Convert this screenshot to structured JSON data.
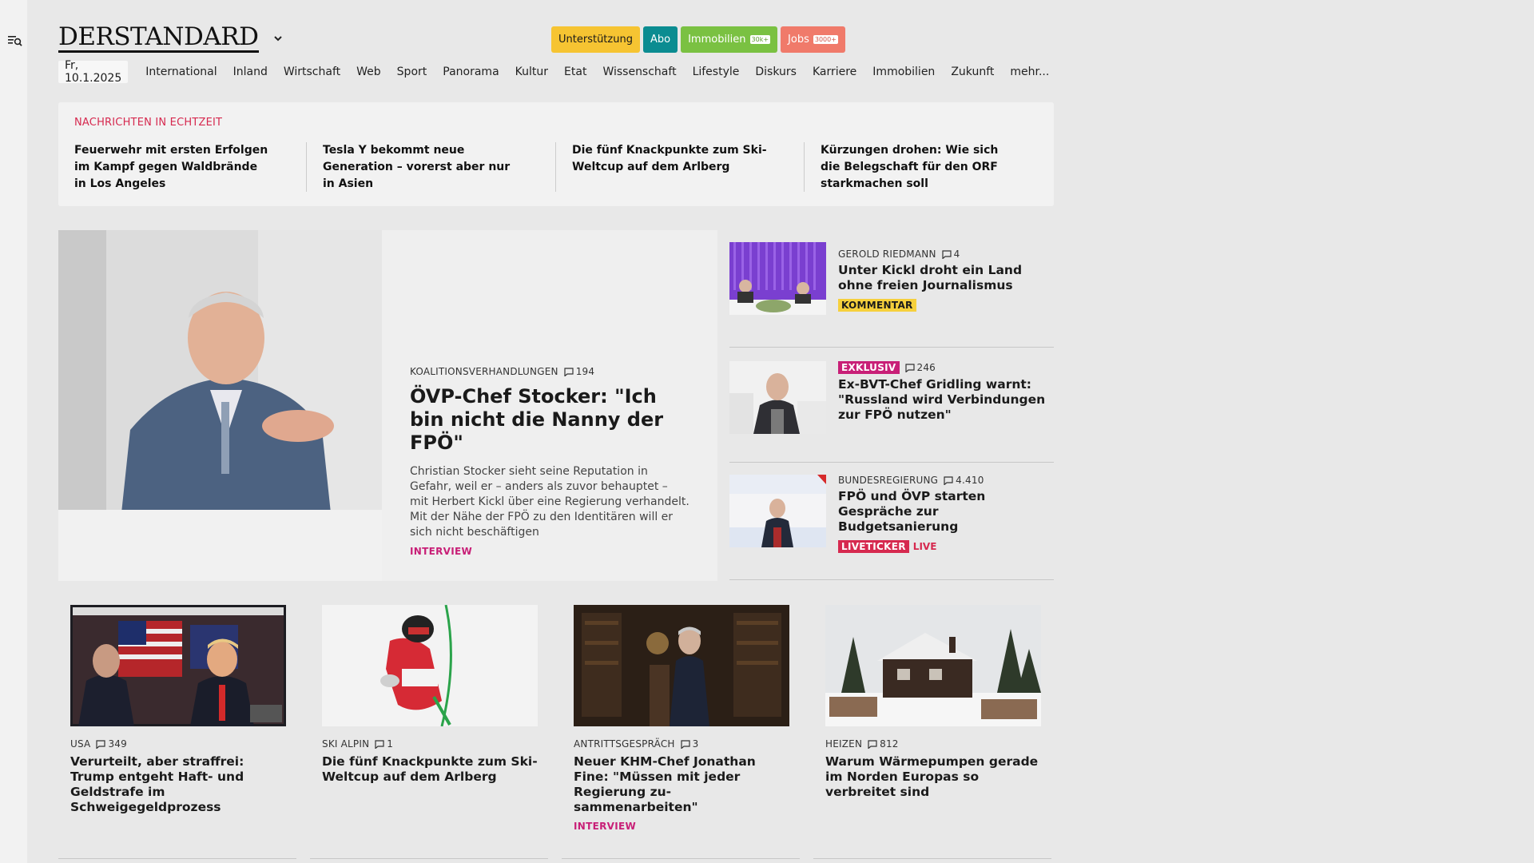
{
  "header": {
    "logo": "DERSTANDARD",
    "buttons": {
      "support": "Unterstützung",
      "abo": "Abo",
      "immobilien": "Immobilien",
      "immobilien_badge": "30k+",
      "jobs": "Jobs",
      "jobs_badge": "3000+"
    }
  },
  "nav": {
    "date": "Fr, 10.1.2025",
    "items": [
      "International",
      "Inland",
      "Wirtschaft",
      "Web",
      "Sport",
      "Panorama",
      "Kultur",
      "Etat",
      "Wissenschaft",
      "Lifestyle",
      "Diskurs",
      "Karriere",
      "Immobilien",
      "Zukunft",
      "mehr..."
    ]
  },
  "realtime": {
    "label": "NACHRICHTEN IN ECHTZEIT",
    "items": [
      "Feuerwehr mit ersten Erfolgen im Kampf gegen Waldbrände in Los Angeles",
      "Tesla Y bekommt neue Generation – vorerst aber nur in Asien",
      "Die fünf Knackpunkte zum Ski-Welt­cup auf dem Arlberg",
      "Kürzungen drohen: Wie sich die Be­legschaft für den ORF starkmachen soll"
    ]
  },
  "hero": {
    "kicker": "KOALITIONSVERHANDLUNGEN",
    "comments": "194",
    "title": "ÖVP-Chef Stocker: \"Ich bin nicht die Nanny der FPÖ\"",
    "teaser": "Christian Stocker sieht seine Reputation in Gefahr, weil er – anders als zuvor behauptet – mit Herbert Kickl über eine Regierung verhandelt. Mit der Nähe der FPÖ zu den Identitären will er sich nicht beschäftigen",
    "tag": "INTERVIEW"
  },
  "side": [
    {
      "kicker": "GEROLD RIEDMANN",
      "comments": "4",
      "title": "Unter Kickl droht ein Land ohne freien Journalismus",
      "badge": "KOMMENTAR"
    },
    {
      "badge": "EXKLUSIV",
      "comments": "246",
      "title": "Ex-BVT-Chef Gridling warnt: \"Russland wird Verbindungen zur FPÖ nutzen\""
    },
    {
      "kicker": "BUNDESREGIERUNG",
      "comments": "4.410",
      "title": "FPÖ und ÖVP starten Gespräche zur Budgetsanierung",
      "badge": "LIVETICKER",
      "live": "LIVE"
    }
  ],
  "cards": [
    {
      "kicker": "USA",
      "comments": "349",
      "title": "Verurteilt, aber straffrei: Trump entgeht Haft- und Geldstrafe im Schweigegeldprozess"
    },
    {
      "kicker": "SKI ALPIN",
      "comments": "1",
      "title": "Die fünf Knackpunkte zum Ski-Weltcup auf dem Arlberg"
    },
    {
      "kicker": "ANTRITTSGESPRÄCH",
      "comments": "3",
      "title": "Neuer KHM-Chef Jonathan Fine: \"Müssen mit jeder Regierung zu­sammenarbeiten\"",
      "tag": "INTERVIEW"
    },
    {
      "kicker": "HEIZEN",
      "comments": "812",
      "title": "Warum Wärmepumpen gerade im Norden Europas so verbreitet sind"
    }
  ]
}
